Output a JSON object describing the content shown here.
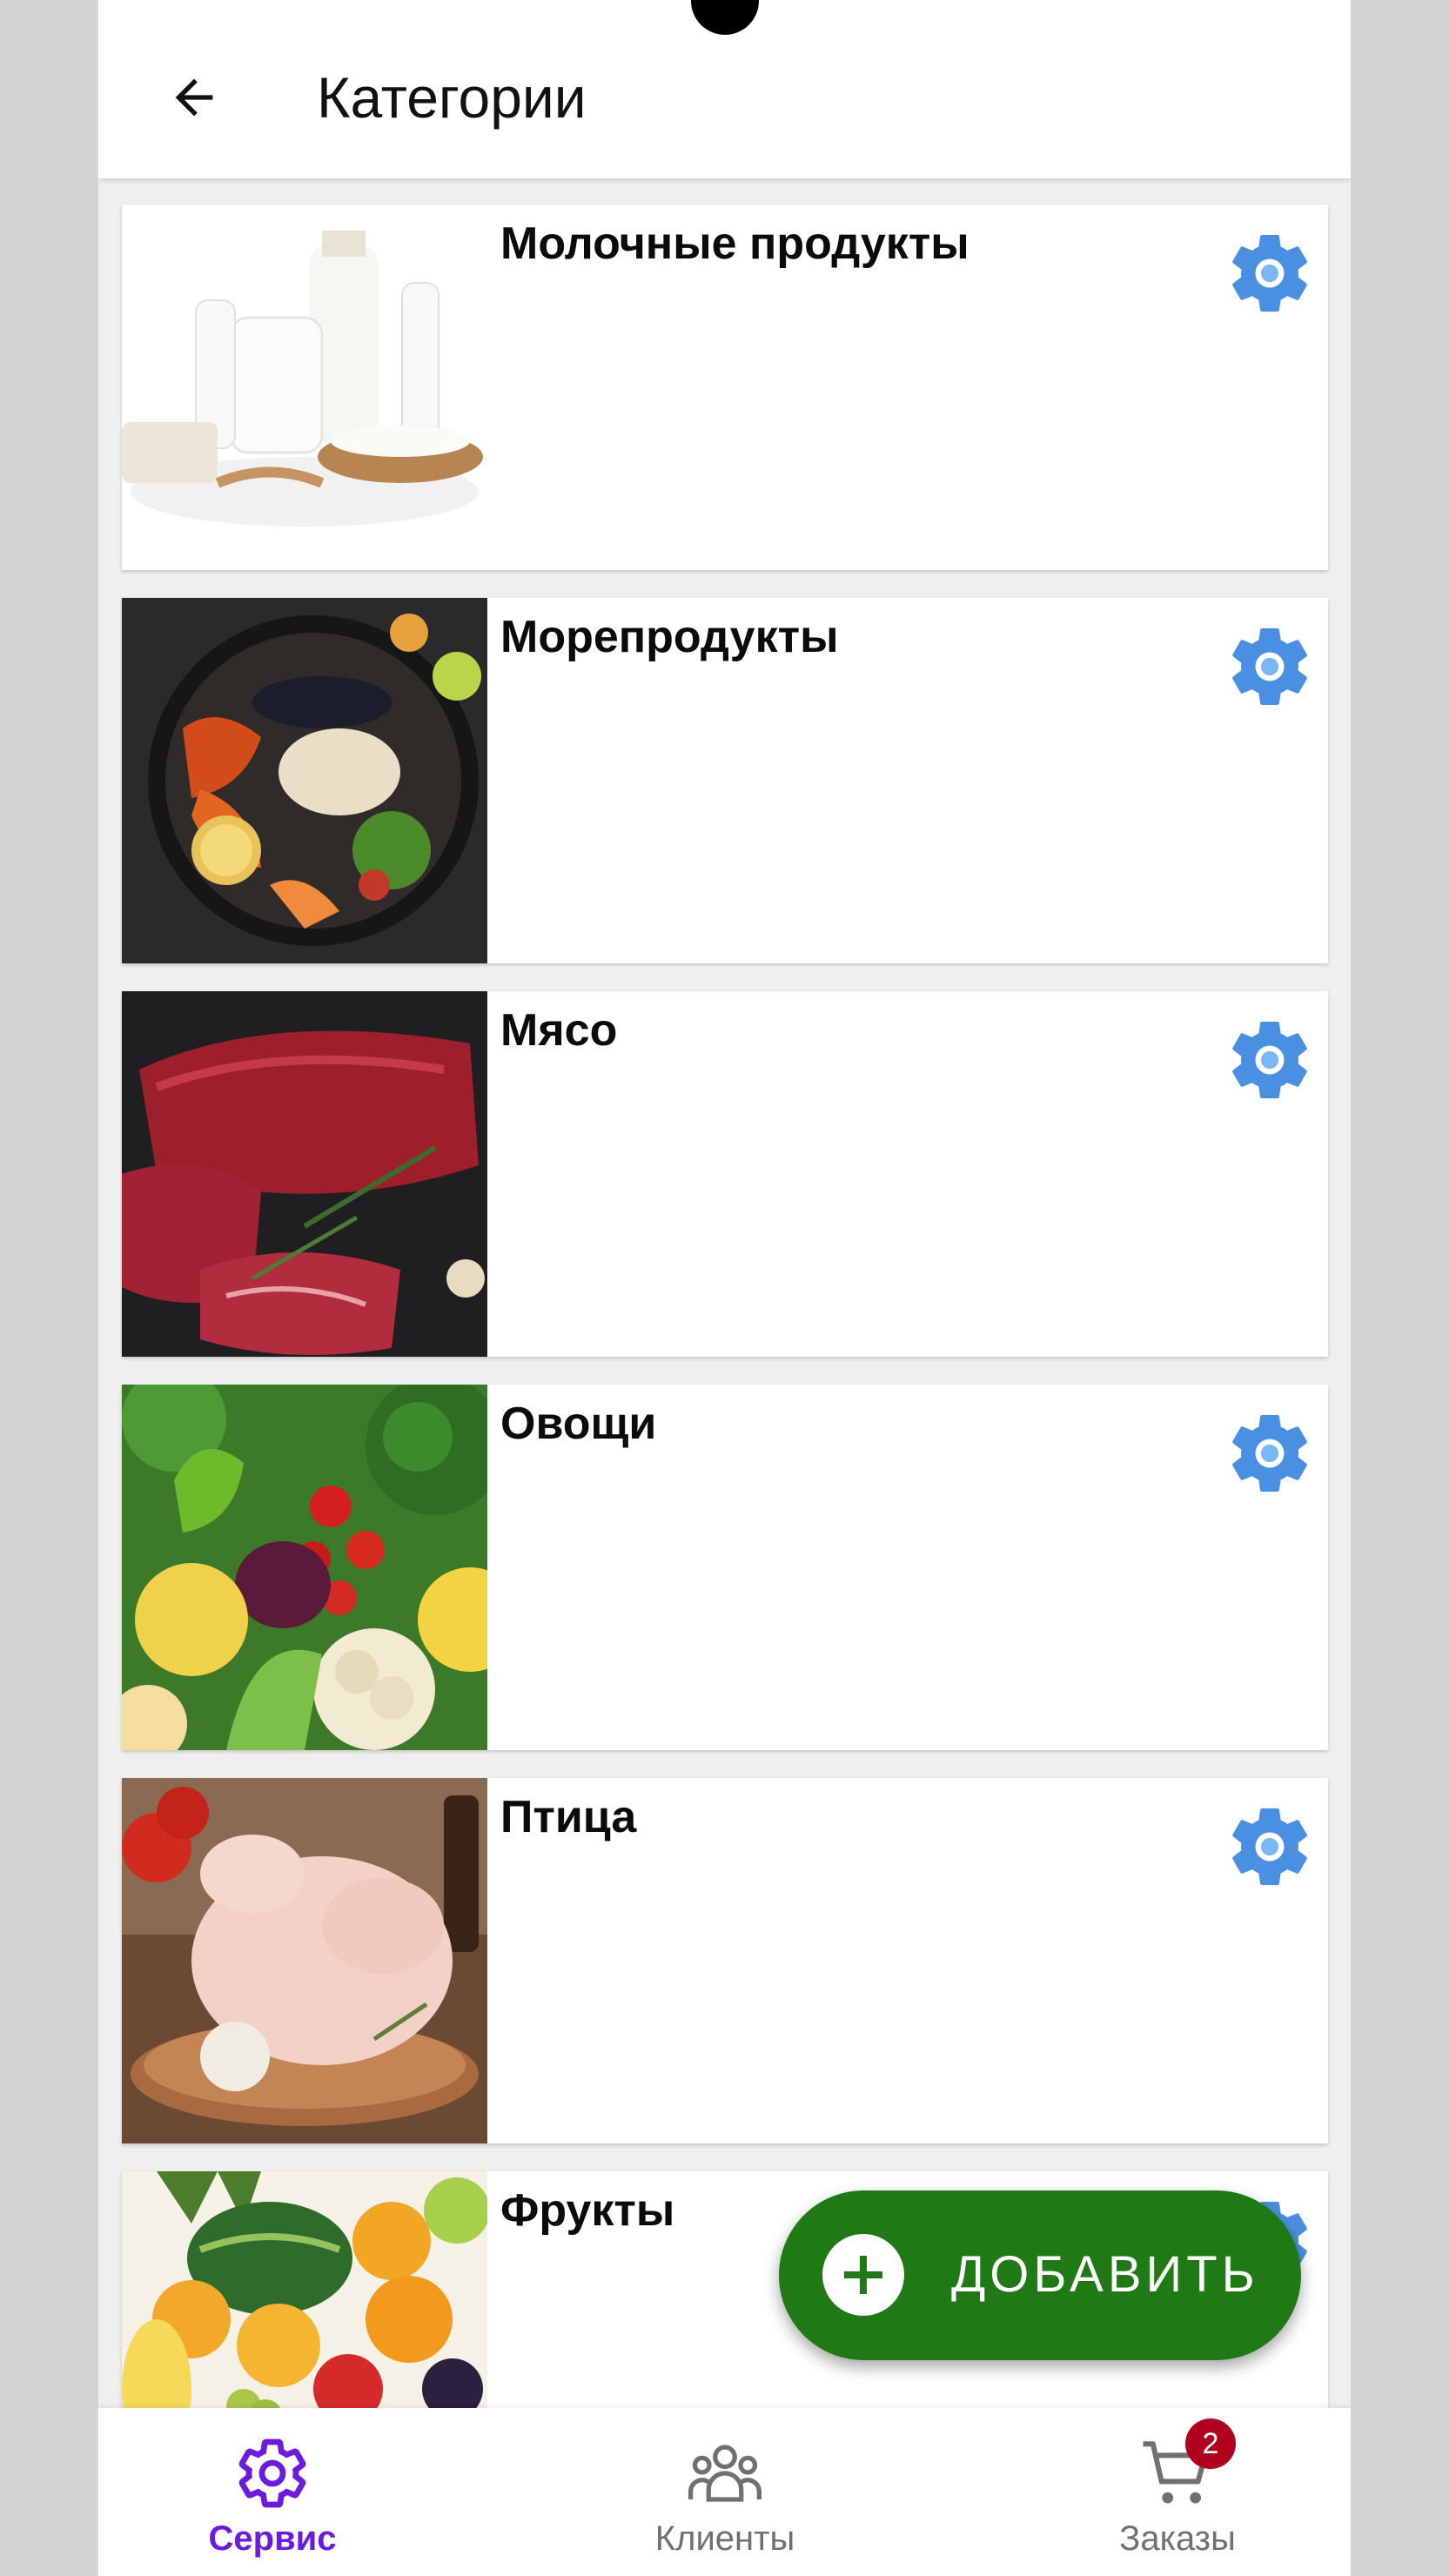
{
  "header": {
    "title": "Категории"
  },
  "categories": [
    {
      "name": "Молочные продукты"
    },
    {
      "name": "Морепродукты"
    },
    {
      "name": "Мясо"
    },
    {
      "name": "Овощи"
    },
    {
      "name": "Птица"
    },
    {
      "name": "Фрукты"
    }
  ],
  "fab": {
    "label": "ДОБАВИТЬ"
  },
  "bottom_nav": [
    {
      "label": "Сервис",
      "icon": "gear-icon",
      "active": true
    },
    {
      "label": "Клиенты",
      "icon": "people-icon",
      "active": false
    },
    {
      "label": "Заказы",
      "icon": "cart-icon",
      "active": false,
      "badge": "2"
    }
  ],
  "colors": {
    "accent": "#6a1bdc",
    "fab": "#1f7a16",
    "gear": "#4a90e2",
    "badge": "#b00020",
    "inactive": "#707070"
  }
}
